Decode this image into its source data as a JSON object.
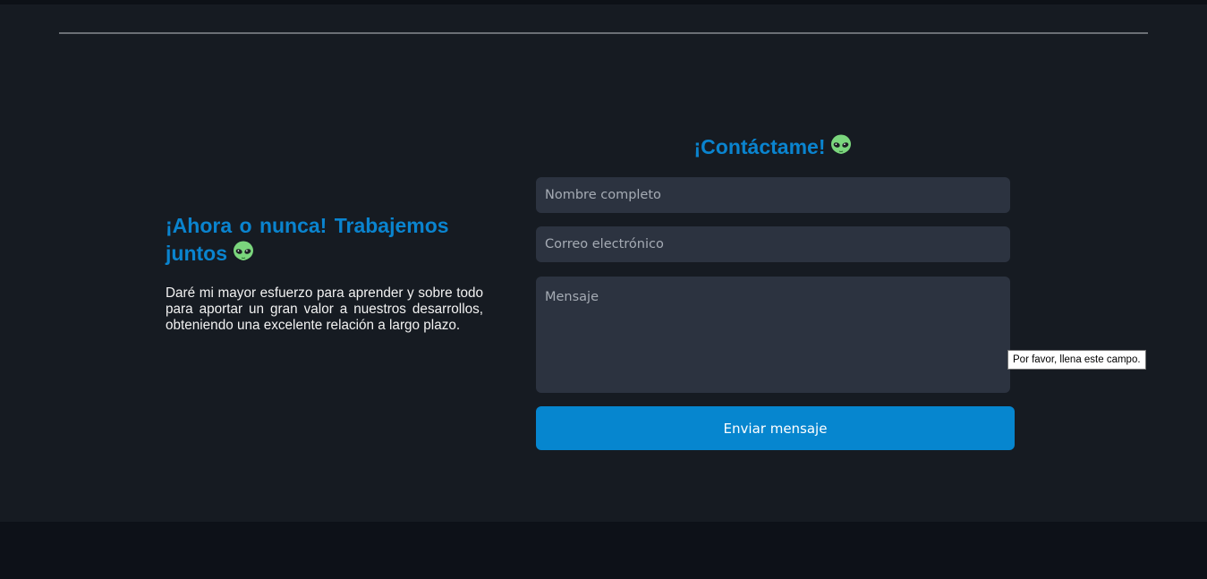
{
  "intro": {
    "title": "¡Ahora o nunca! Trabajemos juntos",
    "title_icon": "alien-icon",
    "body": "Daré mi mayor esfuerzo para aprender y sobre todo para aportar un gran valor a nuestros desarrollos, obteniendo una excelente relación a largo plazo."
  },
  "contact": {
    "title": "¡Contáctame!",
    "title_icon": "alien-icon",
    "name_placeholder": "Nombre completo",
    "email_placeholder": "Correo electrónico",
    "message_placeholder": "Mensaje",
    "submit_label": "Enviar mensaje",
    "validation_tooltip": "Por favor, llena este campo."
  },
  "colors": {
    "accent": "#0a84cf",
    "button": "#0686cf",
    "section_bg": "#161b22",
    "field_bg": "#2c3340",
    "page_bg": "#0e131b"
  }
}
